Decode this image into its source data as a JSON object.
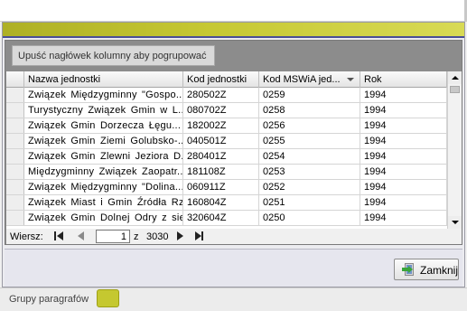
{
  "colors": {
    "title_bar": "#c6c833",
    "tab_accent": "#c5c830",
    "grid_background": "#8c8c8c"
  },
  "grid": {
    "group_panel_text": "Upuść nagłówek kolumny aby pogrupować",
    "columns": [
      "Nazwa jednostki",
      "Kod jednostki",
      "Kod  MSWiA jed...",
      "Rok"
    ],
    "sorted_column": "Kod  MSWiA jed...",
    "sort_direction": "descending",
    "rows": [
      {
        "name": "Związek Międzygminny \"Gospo...",
        "kod": "280502Z",
        "msw": "0259",
        "rok": "1994"
      },
      {
        "name": "Turystyczny Związek Gmin w L...",
        "kod": "080702Z",
        "msw": "0258",
        "rok": "1994"
      },
      {
        "name": "Związek Gmin Dorzecza Łęgu...",
        "kod": "182002Z",
        "msw": "0256",
        "rok": "1994"
      },
      {
        "name": "Związek Gmin Ziemi Golubsko-...",
        "kod": "040501Z",
        "msw": "0255",
        "rok": "1994"
      },
      {
        "name": "Związek Gmin Zlewni Jeziora D...",
        "kod": "280401Z",
        "msw": "0254",
        "rok": "1994"
      },
      {
        "name": "Międzygminny Związek Zaopatr...",
        "kod": "181108Z",
        "msw": "0253",
        "rok": "1994"
      },
      {
        "name": "Związek Międzygminny \"Dolina...",
        "kod": "060911Z",
        "msw": "0252",
        "rok": "1994"
      },
      {
        "name": "Związek Miast i Gmin Źródła Rz...",
        "kod": "160804Z",
        "msw": "0251",
        "rok": "1994"
      },
      {
        "name": "Związek Gmin Dolnej Odry z sie...",
        "kod": "320604Z",
        "msw": "0250",
        "rok": "1994"
      }
    ]
  },
  "navigator": {
    "label": "Wiersz:",
    "current_page": "1",
    "of_label": "z",
    "total": "3030"
  },
  "buttons": {
    "close": "Zamknij"
  },
  "tabs": {
    "label": "Grupy paragrafów"
  },
  "icons": [
    "first-page-icon",
    "previous-page-icon",
    "next-page-icon",
    "last-page-icon",
    "exit-door-icon",
    "sort-desc-icon",
    "scroll-up-icon",
    "scroll-down-icon"
  ]
}
